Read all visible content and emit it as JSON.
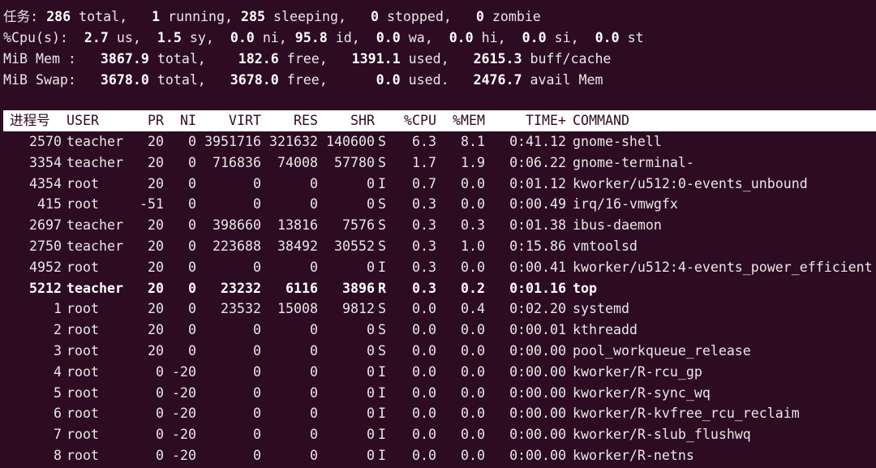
{
  "summary": {
    "tasks": {
      "label": "任务:",
      "total": "286",
      "total_label": "total,",
      "running": "1",
      "running_label": "running,",
      "sleeping": "285",
      "sleeping_label": "sleeping,",
      "stopped": "0",
      "stopped_label": "stopped,",
      "zombie": "0",
      "zombie_label": "zombie"
    },
    "cpu": {
      "label": "%Cpu(s):",
      "us": "2.7",
      "us_label": "us,",
      "sy": "1.5",
      "sy_label": "sy,",
      "ni": "0.0",
      "ni_label": "ni,",
      "id": "95.8",
      "id_label": "id,",
      "wa": "0.0",
      "wa_label": "wa,",
      "hi": "0.0",
      "hi_label": "hi,",
      "si": "0.0",
      "si_label": "si,",
      "st": "0.0",
      "st_label": "st"
    },
    "mem": {
      "label": "MiB Mem :",
      "total": "3867.9",
      "total_label": "total,",
      "free": "182.6",
      "free_label": "free,",
      "used": "1391.1",
      "used_label": "used,",
      "cache": "2615.3",
      "cache_label": "buff/cache"
    },
    "swap": {
      "label": "MiB Swap:",
      "total": "3678.0",
      "total_label": "total,",
      "free": "3678.0",
      "free_label": "free,",
      "used": "0.0",
      "used_label": "used.",
      "avail": "2476.7",
      "avail_label": "avail Mem"
    }
  },
  "columns": [
    "进程号",
    "USER",
    "PR",
    "NI",
    "VIRT",
    "RES",
    "SHR",
    "",
    "%CPU",
    "%MEM",
    "TIME+",
    "COMMAND"
  ],
  "processes": [
    {
      "pid": "2570",
      "user": "teacher",
      "pr": "20",
      "ni": "0",
      "virt": "3951716",
      "res": "321632",
      "shr": "140600",
      "s": "S",
      "cpu": "6.3",
      "mem": "8.1",
      "time": "0:41.12",
      "cmd": "gnome-shell",
      "bold": false
    },
    {
      "pid": "3354",
      "user": "teacher",
      "pr": "20",
      "ni": "0",
      "virt": "716836",
      "res": "74008",
      "shr": "57780",
      "s": "S",
      "cpu": "1.7",
      "mem": "1.9",
      "time": "0:06.22",
      "cmd": "gnome-terminal-",
      "bold": false
    },
    {
      "pid": "4354",
      "user": "root",
      "pr": "20",
      "ni": "0",
      "virt": "0",
      "res": "0",
      "shr": "0",
      "s": "I",
      "cpu": "0.7",
      "mem": "0.0",
      "time": "0:01.12",
      "cmd": "kworker/u512:0-events_unbound",
      "bold": false
    },
    {
      "pid": "415",
      "user": "root",
      "pr": "-51",
      "ni": "0",
      "virt": "0",
      "res": "0",
      "shr": "0",
      "s": "S",
      "cpu": "0.3",
      "mem": "0.0",
      "time": "0:00.49",
      "cmd": "irq/16-vmwgfx",
      "bold": false
    },
    {
      "pid": "2697",
      "user": "teacher",
      "pr": "20",
      "ni": "0",
      "virt": "398660",
      "res": "13816",
      "shr": "7576",
      "s": "S",
      "cpu": "0.3",
      "mem": "0.3",
      "time": "0:01.38",
      "cmd": "ibus-daemon",
      "bold": false
    },
    {
      "pid": "2750",
      "user": "teacher",
      "pr": "20",
      "ni": "0",
      "virt": "223688",
      "res": "38492",
      "shr": "30552",
      "s": "S",
      "cpu": "0.3",
      "mem": "1.0",
      "time": "0:15.86",
      "cmd": "vmtoolsd",
      "bold": false
    },
    {
      "pid": "4952",
      "user": "root",
      "pr": "20",
      "ni": "0",
      "virt": "0",
      "res": "0",
      "shr": "0",
      "s": "I",
      "cpu": "0.3",
      "mem": "0.0",
      "time": "0:00.41",
      "cmd": "kworker/u512:4-events_power_efficient",
      "bold": false
    },
    {
      "pid": "5212",
      "user": "teacher",
      "pr": "20",
      "ni": "0",
      "virt": "23232",
      "res": "6116",
      "shr": "3896",
      "s": "R",
      "cpu": "0.3",
      "mem": "0.2",
      "time": "0:01.16",
      "cmd": "top",
      "bold": true
    },
    {
      "pid": "1",
      "user": "root",
      "pr": "20",
      "ni": "0",
      "virt": "23532",
      "res": "15008",
      "shr": "9812",
      "s": "S",
      "cpu": "0.0",
      "mem": "0.4",
      "time": "0:02.20",
      "cmd": "systemd",
      "bold": false
    },
    {
      "pid": "2",
      "user": "root",
      "pr": "20",
      "ni": "0",
      "virt": "0",
      "res": "0",
      "shr": "0",
      "s": "S",
      "cpu": "0.0",
      "mem": "0.0",
      "time": "0:00.01",
      "cmd": "kthreadd",
      "bold": false
    },
    {
      "pid": "3",
      "user": "root",
      "pr": "20",
      "ni": "0",
      "virt": "0",
      "res": "0",
      "shr": "0",
      "s": "S",
      "cpu": "0.0",
      "mem": "0.0",
      "time": "0:00.00",
      "cmd": "pool_workqueue_release",
      "bold": false
    },
    {
      "pid": "4",
      "user": "root",
      "pr": "0",
      "ni": "-20",
      "virt": "0",
      "res": "0",
      "shr": "0",
      "s": "I",
      "cpu": "0.0",
      "mem": "0.0",
      "time": "0:00.00",
      "cmd": "kworker/R-rcu_gp",
      "bold": false
    },
    {
      "pid": "5",
      "user": "root",
      "pr": "0",
      "ni": "-20",
      "virt": "0",
      "res": "0",
      "shr": "0",
      "s": "I",
      "cpu": "0.0",
      "mem": "0.0",
      "time": "0:00.00",
      "cmd": "kworker/R-sync_wq",
      "bold": false
    },
    {
      "pid": "6",
      "user": "root",
      "pr": "0",
      "ni": "-20",
      "virt": "0",
      "res": "0",
      "shr": "0",
      "s": "I",
      "cpu": "0.0",
      "mem": "0.0",
      "time": "0:00.00",
      "cmd": "kworker/R-kvfree_rcu_reclaim",
      "bold": false
    },
    {
      "pid": "7",
      "user": "root",
      "pr": "0",
      "ni": "-20",
      "virt": "0",
      "res": "0",
      "shr": "0",
      "s": "I",
      "cpu": "0.0",
      "mem": "0.0",
      "time": "0:00.00",
      "cmd": "kworker/R-slub_flushwq",
      "bold": false
    },
    {
      "pid": "8",
      "user": "root",
      "pr": "0",
      "ni": "-20",
      "virt": "0",
      "res": "0",
      "shr": "0",
      "s": "I",
      "cpu": "0.0",
      "mem": "0.0",
      "time": "0:00.00",
      "cmd": "kworker/R-netns",
      "bold": false
    }
  ]
}
